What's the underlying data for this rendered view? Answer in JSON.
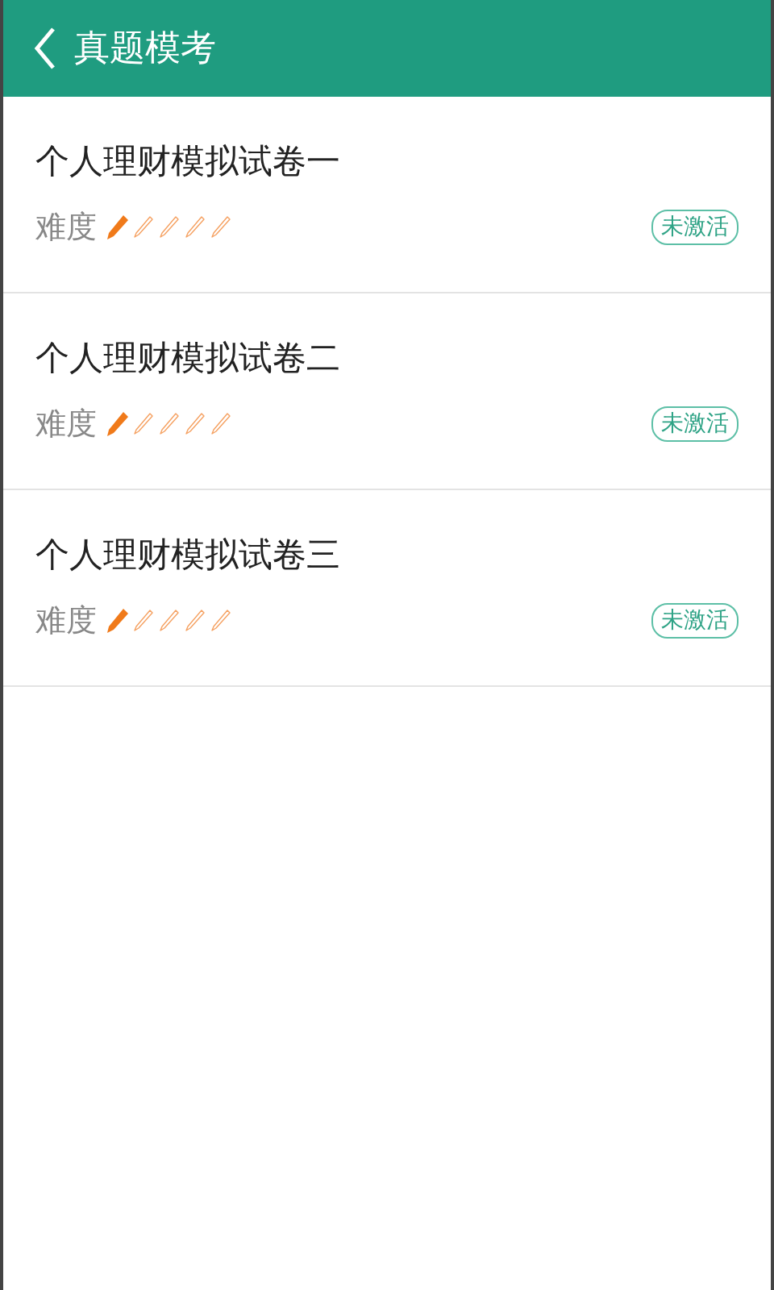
{
  "header": {
    "title": "真题模考"
  },
  "papers": [
    {
      "title": "个人理财模拟试卷一",
      "difficulty_label": "难度",
      "stars": 1,
      "status": "未激活"
    },
    {
      "title": "个人理财模拟试卷二",
      "difficulty_label": "难度",
      "stars": 1,
      "status": "未激活"
    },
    {
      "title": "个人理财模拟试卷三",
      "difficulty_label": "难度",
      "stars": 1,
      "status": "未激活"
    }
  ]
}
